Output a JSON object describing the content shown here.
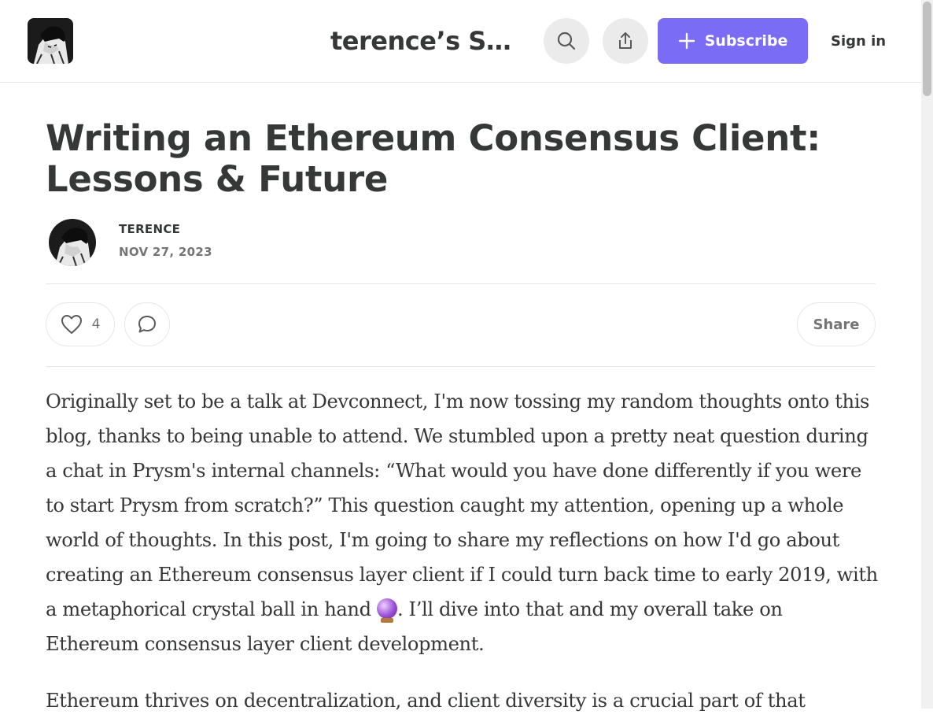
{
  "header": {
    "publication_title": "terence’s Su…",
    "logo_icon": "manga-portrait-logo",
    "search_icon": "search-icon",
    "share_icon": "share-upload-icon",
    "subscribe_label": "Subscribe",
    "signin_label": "Sign in",
    "accent_color": "#7b6cf6"
  },
  "post": {
    "title": "Writing an Ethereum Consensus Client: Lessons & Future",
    "author": "TERENCE",
    "date": "NOV 27, 2023",
    "likes": "4",
    "share_label": "Share",
    "paragraphs": [
      {
        "before_emoji": "Originally set to be a talk at Devconnect, I'm now tossing my random thoughts onto this blog, thanks to being unable to attend. We stumbled upon a pretty neat question during a chat in Prysm's internal channels: “What would you have done differently if you were to start Prysm from scratch?” This question caught my attention, opening up a whole world of thoughts. In this post, I'm going to share my reflections on how I'd go about creating an Ethereum consensus layer client if I could turn back time to early 2019, with a metaphorical crystal ball in hand ",
        "emoji": "crystal-ball-icon",
        "after_emoji": ". I’ll dive into that and my overall take on Ethereum consensus layer client development."
      },
      {
        "text": "Ethereum thrives on decentralization, and client diversity is a crucial part of that"
      }
    ]
  }
}
